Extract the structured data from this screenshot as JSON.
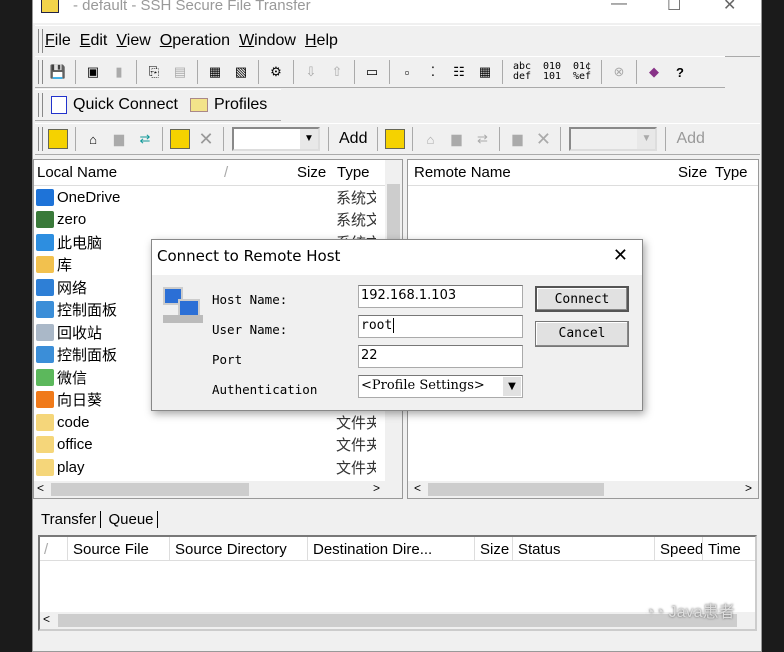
{
  "window": {
    "title": "- default - SSH Secure File Transfer",
    "min": "—",
    "max": "☐",
    "close": "✕"
  },
  "menu": [
    {
      "l": "F",
      "r": "ile"
    },
    {
      "l": "E",
      "r": "dit"
    },
    {
      "l": "V",
      "r": "iew"
    },
    {
      "l": "O",
      "r": "peration"
    },
    {
      "l": "W",
      "r": "indow"
    },
    {
      "l": "H",
      "r": "elp"
    }
  ],
  "toolbar_icons": [
    "save-icon",
    "computer-icon",
    "disconnect-icon",
    "copy-icon",
    "paste-icon",
    "new-terminal-icon",
    "new-file-transfer-icon",
    "settings-icon",
    "download-icon",
    "upload-icon",
    "view-icon",
    "large-icons-icon",
    "small-icons-icon",
    "list-icon",
    "details-icon",
    "ascii-icon",
    "binary-icon",
    "auto-icon",
    "stop-icon",
    "help-book-icon",
    "whats-this-icon"
  ],
  "toolbar_text": {
    "ascii": "abc\ndef",
    "binary": "010\n101",
    "auto": "01¢\n%ef",
    "whatsthis": "?"
  },
  "quick": {
    "connect": "Quick Connect",
    "profiles": "Profiles"
  },
  "nav": {
    "add_local": "Add",
    "add_remote": "Add"
  },
  "local": {
    "headers": {
      "name": "Local Name",
      "size": "Size",
      "type": "Type"
    },
    "items": [
      {
        "name": "OneDrive",
        "type": "系统文件夹",
        "color": "#1e73d8"
      },
      {
        "name": "zero",
        "type": "系统文件夹",
        "color": "#3a7a3a"
      },
      {
        "name": "此电脑",
        "type": "系统文件夹",
        "color": "#2d8ee0"
      },
      {
        "name": "库",
        "type": "",
        "color": "#f2c14e"
      },
      {
        "name": "网络",
        "type": "",
        "color": "#2e7fd6"
      },
      {
        "name": "控制面板",
        "type": "",
        "color": "#3b8ed8"
      },
      {
        "name": "回收站",
        "type": "",
        "color": "#aab8c8"
      },
      {
        "name": "控制面板",
        "type": "",
        "color": "#3b8ed8"
      },
      {
        "name": "微信",
        "type": "",
        "color": "#5cb85c"
      },
      {
        "name": "向日葵",
        "type": "",
        "color": "#f07a1a"
      },
      {
        "name": "code",
        "type": "文件夹",
        "color": "#f5d67a"
      },
      {
        "name": "office",
        "type": "文件夹",
        "color": "#f5d67a"
      },
      {
        "name": "play",
        "type": "文件夹",
        "color": "#f5d67a"
      }
    ]
  },
  "remote": {
    "headers": {
      "name": "Remote Name",
      "size": "Size",
      "type": "Type"
    }
  },
  "dialog": {
    "title": "Connect to Remote Host",
    "host_label": "Host Name:",
    "user_label": "User Name:",
    "port_label": "Port",
    "auth_label": "Authentication",
    "host": "192.168.1.103",
    "user": "root",
    "port": "22",
    "auth": "<Profile Settings>",
    "connect": "Connect",
    "cancel": "Cancel"
  },
  "transfer": {
    "tabs": [
      "Transfer",
      "Queue"
    ],
    "headers": [
      "/",
      "Source File",
      "Source Directory",
      "Destination Dire...",
      "Size",
      "Status",
      "Speed",
      "Time"
    ]
  },
  "watermark": "Java患者"
}
